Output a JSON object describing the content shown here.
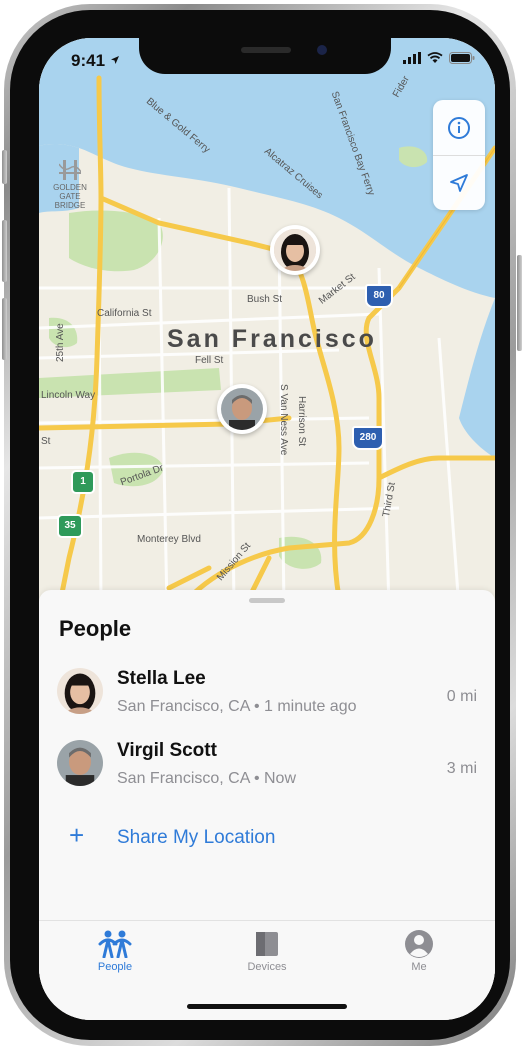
{
  "status_bar": {
    "time": "9:41"
  },
  "map": {
    "city": "San Francisco",
    "golden_gate": "GOLDEN GATE BRIDGE",
    "streets": {
      "ferry": "Blue & Gold Ferry",
      "alcatraz": "Alcatraz Cruises",
      "sf_bay_ferry": "San Francisco Bay Ferry",
      "fider": "Fider",
      "california": "California St",
      "bush": "Bush St",
      "market": "Market St",
      "fell": "Fell St",
      "ave25": "25th Ave",
      "lincoln": "Lincoln Way",
      "st": "St",
      "portola": "Portola Dr",
      "monterey": "Monterey Blvd",
      "mission": "Mission St",
      "van_ness": "S Van Ness Ave",
      "harrison": "Harrison St",
      "third": "Third St"
    },
    "shields": {
      "i80": "80",
      "i280": "280",
      "hwy1": "1",
      "hwy35": "35"
    }
  },
  "controls": {
    "info_icon": "info-icon",
    "location_icon": "location-arrow-icon"
  },
  "sheet": {
    "title": "People",
    "people": [
      {
        "name": "Stella Lee",
        "subtitle": "San Francisco, CA • 1 minute ago",
        "distance": "0 mi"
      },
      {
        "name": "Virgil Scott",
        "subtitle": "San Francisco, CA • Now",
        "distance": "3 mi"
      }
    ],
    "share_label": "Share My Location",
    "share_icon": "plus-icon"
  },
  "tab_bar": {
    "tabs": [
      {
        "label": "People",
        "icon": "people-icon",
        "active": true
      },
      {
        "label": "Devices",
        "icon": "devices-icon",
        "active": false
      },
      {
        "label": "Me",
        "icon": "person-circle-icon",
        "active": false
      }
    ]
  },
  "colors": {
    "accent": "#2f7bd8",
    "inactive": "#8e8e93",
    "water": "#a9d3ee",
    "land": "#f1eee4",
    "park": "#c9e3b0",
    "road": "#f6c94a"
  }
}
